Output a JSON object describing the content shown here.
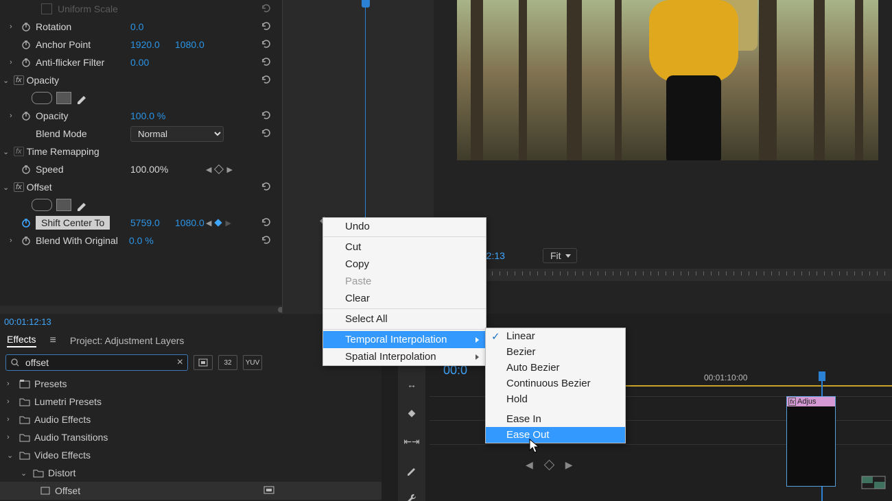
{
  "effects": {
    "rotation": {
      "label": "Rotation",
      "value": "0.0"
    },
    "anchor": {
      "label": "Anchor Point",
      "x": "1920.0",
      "y": "1080.0"
    },
    "flicker": {
      "label": "Anti-flicker Filter",
      "value": "0.00"
    },
    "opacityHdr": "Opacity",
    "opacity": {
      "label": "Opacity",
      "value": "100.0 %"
    },
    "blend": {
      "label": "Blend Mode",
      "value": "Normal"
    },
    "timeHdr": "Time Remapping",
    "speed": {
      "label": "Speed",
      "value": "100.00%"
    },
    "offsetHdr": "Offset",
    "shift": {
      "label": "Shift Center To",
      "x": "5759.0",
      "y": "1080.0"
    },
    "blendOrig": {
      "label": "Blend With Original",
      "value": "0.0 %"
    }
  },
  "monitor": {
    "timecode": ":12:13",
    "fit": "Fit"
  },
  "lowleft": {
    "topTimecode": "00:01:12:13",
    "tabEffects": "Effects",
    "tabProject": "Project: Adjustment Layers",
    "search": "offset",
    "btn32": "32",
    "btnYUV": "YUV",
    "tree": {
      "presets": "Presets",
      "lumetri": "Lumetri Presets",
      "audioFx": "Audio Effects",
      "audioTr": "Audio Transitions",
      "videoFx": "Video Effects",
      "distort": "Distort",
      "offset": "Offset"
    }
  },
  "timeline": {
    "tcPartial": "00:0",
    "rulerLabel": "00:01:10:00",
    "clipLabel": "Adjus"
  },
  "ctx": {
    "undo": "Undo",
    "cut": "Cut",
    "copy": "Copy",
    "paste": "Paste",
    "clear": "Clear",
    "selectAll": "Select All",
    "temporal": "Temporal Interpolation",
    "spatial": "Spatial Interpolation"
  },
  "sub": {
    "linear": "Linear",
    "bezier": "Bezier",
    "auto": "Auto Bezier",
    "cont": "Continuous Bezier",
    "hold": "Hold",
    "easeIn": "Ease In",
    "easeOut": "Ease Out"
  }
}
